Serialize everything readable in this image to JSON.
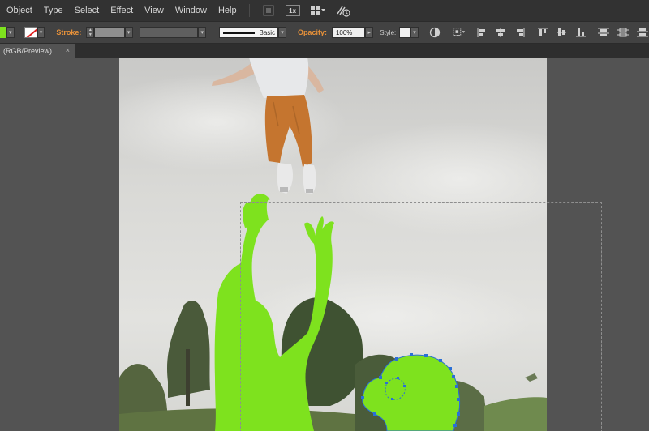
{
  "menu": {
    "items": [
      "Object",
      "Type",
      "Select",
      "Effect",
      "View",
      "Window",
      "Help"
    ],
    "zoom_badge": "1x"
  },
  "control_bar": {
    "fill_color": "#7ee21e",
    "stroke_label": "Stroke:",
    "brush_label": "Basic",
    "opacity_label": "Opacity:",
    "opacity_value": "100%",
    "style_label": "Style:"
  },
  "document": {
    "tab_label": "(RGB/Preview)",
    "tab_close": "×"
  },
  "colors": {
    "selection_fill": "#7ee21e",
    "anchor_point": "#2a6fd6"
  }
}
